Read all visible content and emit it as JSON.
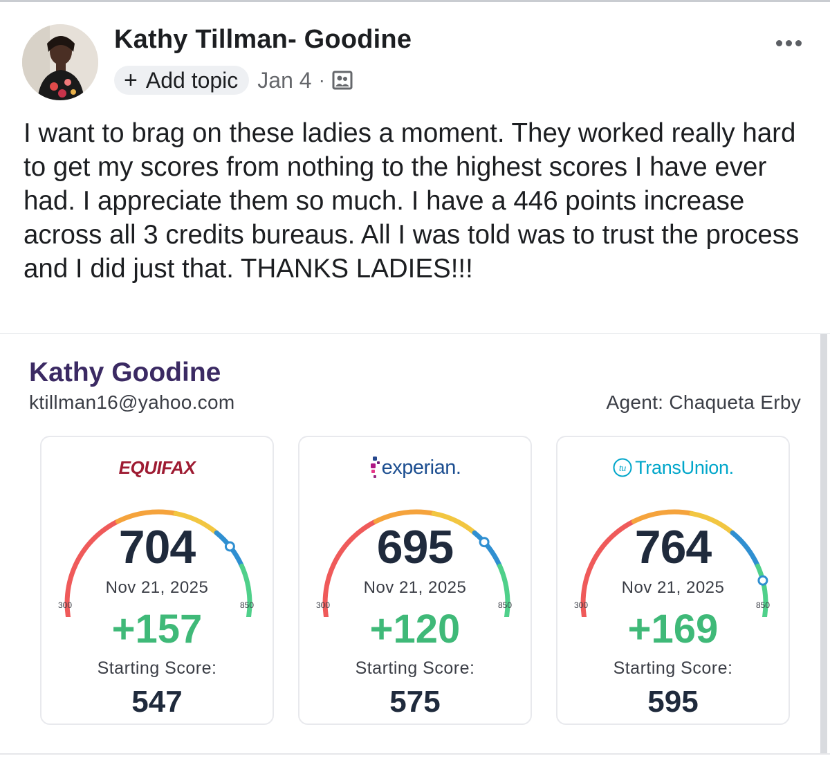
{
  "post": {
    "author": "Kathy Tillman- Goodine",
    "topic_label": "Add topic",
    "date": "Jan 4",
    "separator": "·",
    "audience_icon": "photo-icon",
    "more_icon": "more-options-icon",
    "text": "I want to brag on these ladies a moment. They worked really hard to get my scores from nothing to the highest scores I have ever had. I appreciate them so much. I have a 446 points increase across all 3 credits bureaus. All I was told was to trust the process and I did just that. THANKS LADIES!!!"
  },
  "report": {
    "client_name": "Kathy Goodine",
    "client_email": "ktillman16@yahoo.com",
    "agent": "Agent: Chaqueta Erby",
    "bureaus": [
      {
        "name": "EQUIFAX",
        "score": 704,
        "date": "Nov 21, 2025",
        "scale_min": "300",
        "scale_max": "850",
        "increase": "+157",
        "start_label": "Starting Score:",
        "start_score": 547
      },
      {
        "name": "experian.",
        "score": 695,
        "date": "Nov 21, 2025",
        "scale_min": "300",
        "scale_max": "850",
        "increase": "+120",
        "start_label": "Starting Score:",
        "start_score": 575
      },
      {
        "name": "TransUnion.",
        "score": 764,
        "date": "Nov 21, 2025",
        "scale_min": "300",
        "scale_max": "850",
        "increase": "+169",
        "start_label": "Starting Score:",
        "start_score": 595
      }
    ],
    "colors": {
      "gauge_red": "#ef5a5a",
      "gauge_orange": "#f5a33c",
      "gauge_yellow": "#f2c641",
      "gauge_blue": "#2f8fd1",
      "gauge_green": "#4fd08a",
      "increase_green": "#3fb978",
      "name_purple": "#3b2a63"
    }
  }
}
